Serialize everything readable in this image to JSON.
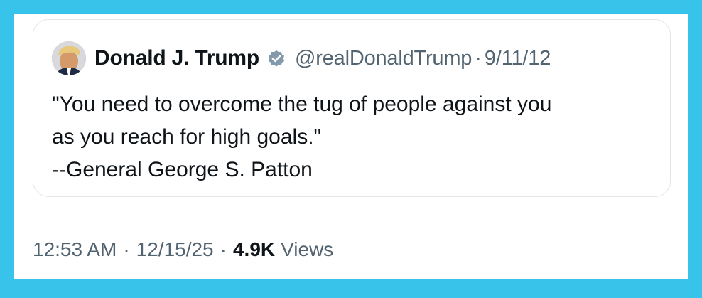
{
  "quoted_tweet": {
    "author_name": "Donald J. Trump",
    "handle": "@realDonaldTrump",
    "separator": "·",
    "date": "9/11/12",
    "verified": true,
    "avatar_icon": "profile-photo",
    "text_lines": [
      "\"You need to overcome the tug of people against you",
      "as you reach for high goals.\"",
      "--General George S. Patton"
    ]
  },
  "post_meta": {
    "time": "12:53 AM",
    "separator": "·",
    "date": "12/15/25",
    "views_count": "4.9K",
    "views_label": "Views"
  },
  "colors": {
    "frame_background": "#38c3ea",
    "card_background": "#ffffff",
    "primary_text": "#0f1419",
    "secondary_text": "#536471",
    "verified_badge": "#829aab",
    "border": "#e1e6ea"
  }
}
